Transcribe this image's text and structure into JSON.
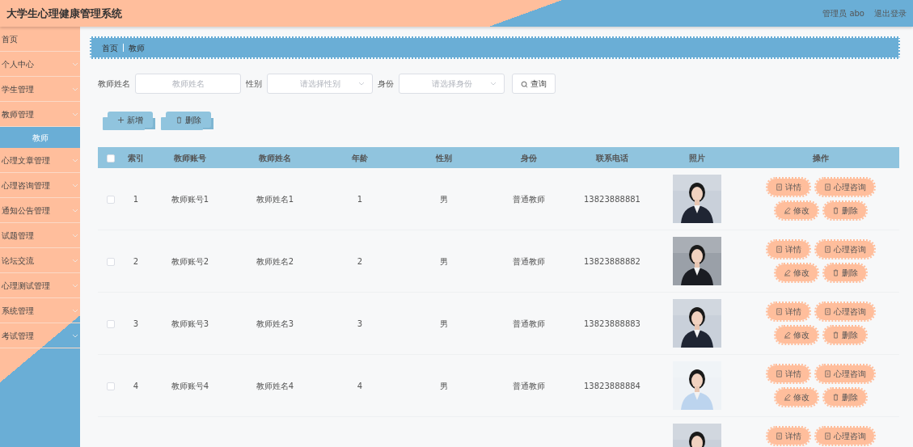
{
  "header": {
    "title": "大学生心理健康管理系统",
    "user": "管理员 abo",
    "logout": "退出登录"
  },
  "sidebar": {
    "items": [
      {
        "label": "首页",
        "expandable": false,
        "selected": false
      },
      {
        "label": "个人中心",
        "expandable": true,
        "selected": false
      },
      {
        "label": "学生管理",
        "expandable": true,
        "selected": false
      },
      {
        "label": "教师管理",
        "expandable": true,
        "selected": false,
        "children": [
          {
            "label": "教师",
            "selected": true
          }
        ]
      },
      {
        "label": "心理文章管理",
        "expandable": true,
        "selected": false
      },
      {
        "label": "心理咨询管理",
        "expandable": true,
        "selected": false
      },
      {
        "label": "通知公告管理",
        "expandable": true,
        "selected": false
      },
      {
        "label": "试题管理",
        "expandable": true,
        "selected": false
      },
      {
        "label": "论坛交流",
        "expandable": true,
        "selected": false
      },
      {
        "label": "心理测试管理",
        "expandable": true,
        "selected": false
      },
      {
        "label": "系统管理",
        "expandable": true,
        "selected": false
      },
      {
        "label": "考试管理",
        "expandable": true,
        "selected": false
      }
    ]
  },
  "breadcrumb": [
    "首页",
    "教师"
  ],
  "search": {
    "fields": [
      {
        "kind": "text",
        "label": "教师姓名",
        "placeholder": "教师姓名"
      },
      {
        "kind": "select",
        "label": "性别",
        "placeholder": "请选择性别"
      },
      {
        "kind": "select",
        "label": "身份",
        "placeholder": "请选择身份"
      }
    ],
    "button": "查询"
  },
  "actions": [
    {
      "kind": "add",
      "label": "新增"
    },
    {
      "kind": "delete",
      "label": "删除"
    }
  ],
  "table": {
    "select_all_checked": false,
    "columns": [
      "索引",
      "教师账号",
      "教师姓名",
      "年龄",
      "性别",
      "身份",
      "联系电话",
      "照片",
      "操作"
    ],
    "rows": [
      {
        "checked": false,
        "cells": [
          "1",
          "教师账号1",
          "教师姓名1",
          "1",
          "男",
          "普通教师",
          "13823888881"
        ],
        "photo": {
          "kind": "picture"
        },
        "buttons": [
          {
            "kind": "detail",
            "label": "详情"
          },
          {
            "kind": "consult",
            "label": "心理咨询"
          },
          {
            "kind": "edit",
            "label": "修改"
          },
          {
            "kind": "delete",
            "label": "删除"
          }
        ]
      },
      {
        "checked": false,
        "cells": [
          "2",
          "教师账号2",
          "教师姓名2",
          "2",
          "男",
          "普通教师",
          "13823888882"
        ],
        "photo": {
          "kind": "picture"
        },
        "buttons": [
          {
            "kind": "detail",
            "label": "详情"
          },
          {
            "kind": "consult",
            "label": "心理咨询"
          },
          {
            "kind": "edit",
            "label": "修改"
          },
          {
            "kind": "delete",
            "label": "删除"
          }
        ]
      },
      {
        "checked": false,
        "cells": [
          "3",
          "教师账号3",
          "教师姓名3",
          "3",
          "男",
          "普通教师",
          "13823888883"
        ],
        "photo": {
          "kind": "picture"
        },
        "buttons": [
          {
            "kind": "detail",
            "label": "详情"
          },
          {
            "kind": "consult",
            "label": "心理咨询"
          },
          {
            "kind": "edit",
            "label": "修改"
          },
          {
            "kind": "delete",
            "label": "删除"
          }
        ]
      },
      {
        "checked": false,
        "cells": [
          "4",
          "教师账号4",
          "教师姓名4",
          "4",
          "男",
          "普通教师",
          "13823888884"
        ],
        "photo": {
          "kind": "picture"
        },
        "buttons": [
          {
            "kind": "detail",
            "label": "详情"
          },
          {
            "kind": "consult",
            "label": "心理咨询"
          },
          {
            "kind": "edit",
            "label": "修改"
          },
          {
            "kind": "delete",
            "label": "删除"
          }
        ]
      },
      {
        "photo": {
          "kind": "picture"
        },
        "buttons": [
          {
            "kind": "detail",
            "label": "详情"
          },
          {
            "kind": "consult",
            "label": "心理咨询"
          }
        ]
      }
    ]
  }
}
